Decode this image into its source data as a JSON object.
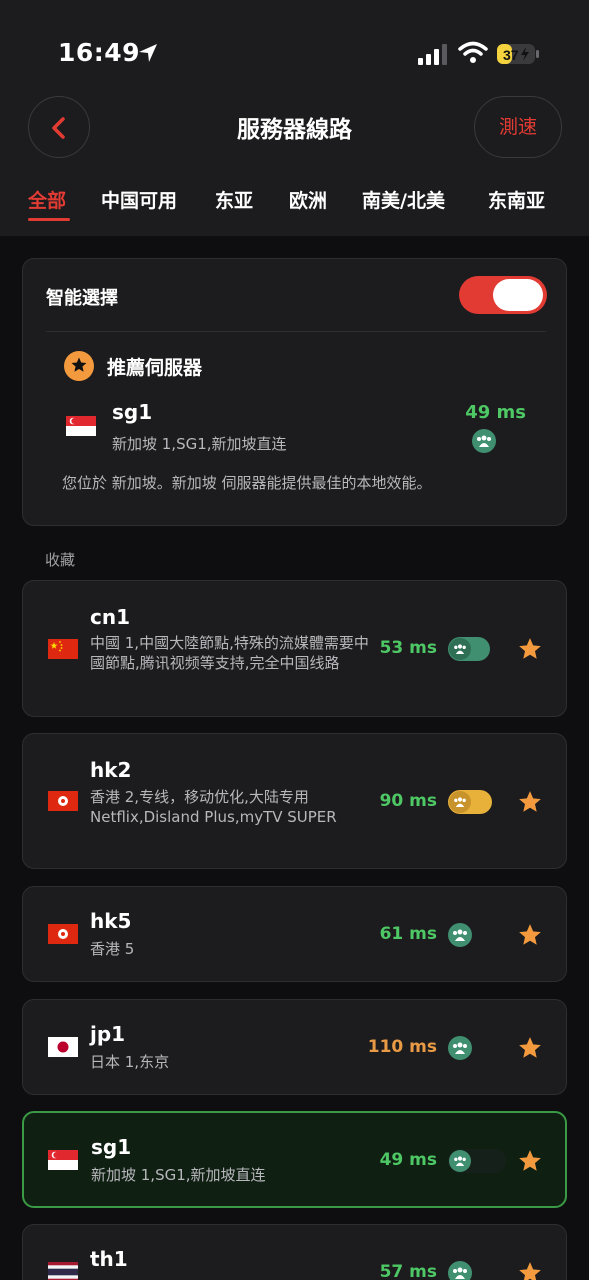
{
  "status": {
    "time": "16:49",
    "battery": "37"
  },
  "header": {
    "title": "服務器線路",
    "speed_test": "測速"
  },
  "tabs": [
    "全部",
    "中国可用",
    "东亚",
    "欧洲",
    "南美/北美",
    "东南亚"
  ],
  "smart": {
    "title": "智能選擇",
    "recommended_title": "推薦伺服器",
    "server_name": "sg1",
    "server_desc": "新加坡 1,SG1,新加坡直连",
    "ping": "49 ms",
    "note": "您位於 新加坡。新加坡 伺服器能提供最佳的本地效能。"
  },
  "favorites_label": "收藏",
  "servers": [
    {
      "name": "cn1",
      "desc": "中國 1,中國大陸節點,特殊的流媒體需要中國節點,腾讯视频等支持,完全中国线路",
      "ping": "53 ms",
      "flag": "china"
    },
    {
      "name": "hk2",
      "desc": "香港 2,专线，移动优化,大陆专用 Netflix,Disland Plus,myTV SUPER",
      "ping": "90 ms",
      "flag": "hong-kong"
    },
    {
      "name": "hk5",
      "desc": "香港 5",
      "ping": "61 ms",
      "flag": "hong-kong"
    },
    {
      "name": "jp1",
      "desc": "日本 1,东京",
      "ping": "110 ms",
      "flag": "japan"
    },
    {
      "name": "sg1",
      "desc": "新加坡 1,SG1,新加坡直连",
      "ping": "49 ms",
      "flag": "singapore"
    },
    {
      "name": "th1",
      "desc": "",
      "ping": "57 ms",
      "flag": "thailand"
    }
  ],
  "colors": {
    "accent": "#e23b33",
    "green": "#4ec765",
    "orange": "#e99a44",
    "star": "#f39a3e"
  }
}
